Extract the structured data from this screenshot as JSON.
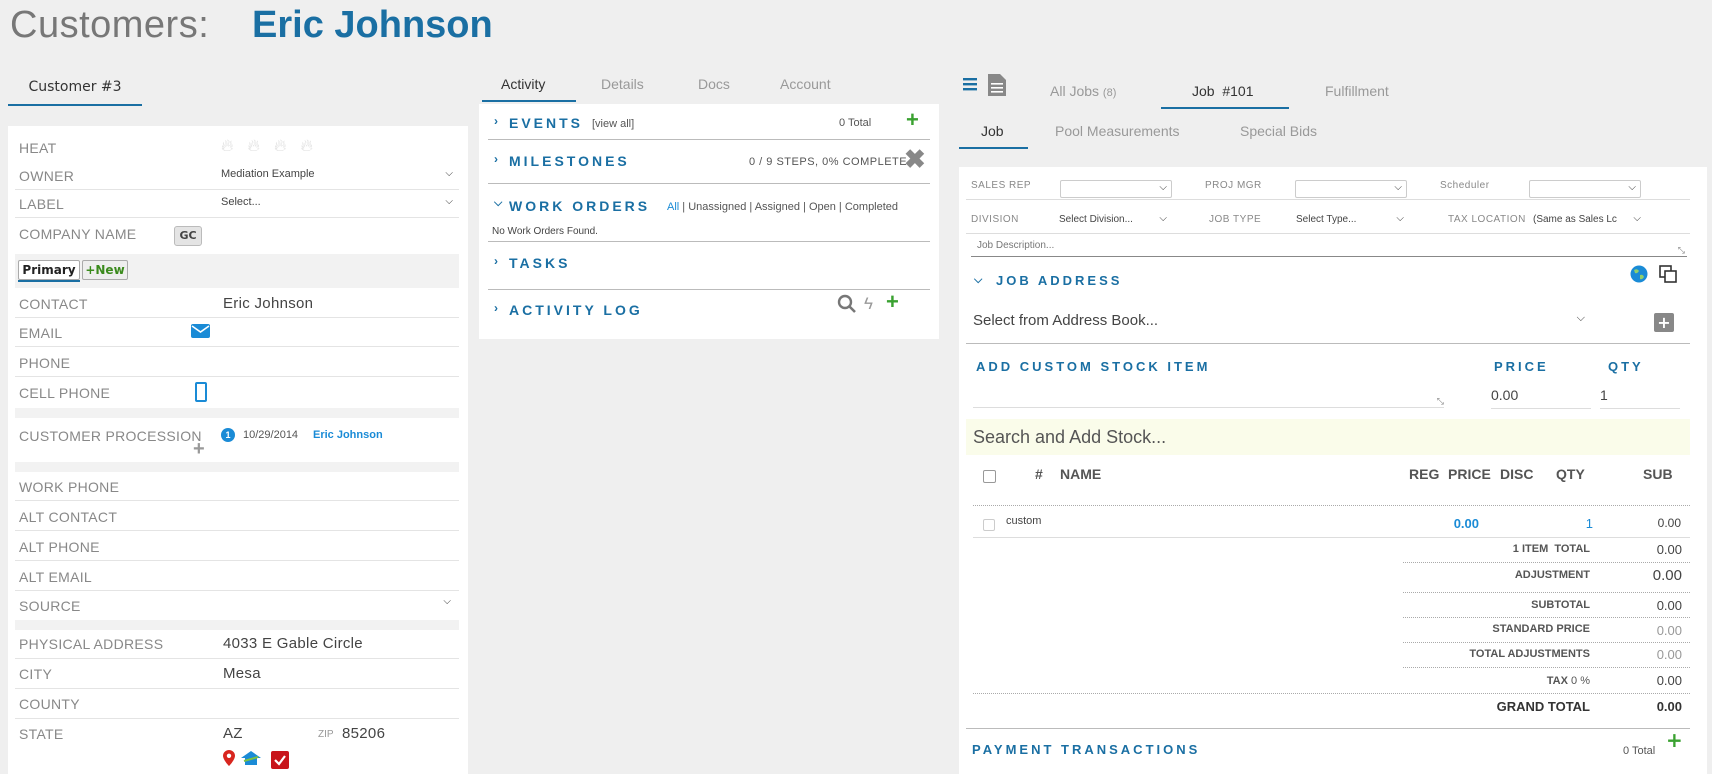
{
  "header": {
    "title": "Customers:",
    "customer_name": "Eric Johnson"
  },
  "left": {
    "tab": "Customer #3",
    "heat_label": "HEAT",
    "owner": {
      "label": "OWNER",
      "value": "Mediation Example"
    },
    "label": {
      "label": "LABEL",
      "value": "Select..."
    },
    "company_name": {
      "label": "COMPANY NAME",
      "button": "GC"
    },
    "primary_pill": "Primary",
    "new_pill": "+New",
    "contact": {
      "label": "CONTACT",
      "value": "Eric Johnson"
    },
    "email": {
      "label": "EMAIL"
    },
    "phone": {
      "label": "PHONE"
    },
    "cell_phone": {
      "label": "CELL PHONE"
    },
    "procession": {
      "label": "CUSTOMER PROCESSION",
      "badge": "1",
      "date": "10/29/2014",
      "name": "Eric Johnson"
    },
    "work_phone": {
      "label": "WORK PHONE"
    },
    "alt_contact": {
      "label": "ALT CONTACT"
    },
    "alt_phone": {
      "label": "ALT PHONE"
    },
    "alt_email": {
      "label": "ALT EMAIL"
    },
    "source": {
      "label": "SOURCE"
    },
    "physical_address": {
      "label": "PHYSICAL ADDRESS",
      "value": "4033 E Gable Circle"
    },
    "city": {
      "label": "CITY",
      "value": "Mesa"
    },
    "county": {
      "label": "COUNTY"
    },
    "state": {
      "label": "STATE",
      "value": "AZ",
      "zip_label": "ZIP",
      "zip_value": "85206"
    }
  },
  "middle": {
    "tabs": [
      "Activity",
      "Details",
      "Docs",
      "Account"
    ],
    "events": {
      "title": "EVENTS",
      "link": "[view all]",
      "total": "0 Total"
    },
    "milestones": {
      "title": "MILESTONES",
      "status": "0 / 9 STEPS, 0% COMPLETE"
    },
    "work_orders": {
      "title": "WORK ORDERS",
      "filters": [
        "All",
        "Unassigned",
        "Assigned",
        "Open",
        "Completed"
      ],
      "empty": "No Work Orders Found."
    },
    "tasks": {
      "title": "TASKS"
    },
    "activity_log": {
      "title": "ACTIVITY LOG"
    }
  },
  "right": {
    "top_tabs": {
      "all_jobs": "All Jobs",
      "all_jobs_count": "(8)",
      "job": "Job  #101",
      "fulfillment": "Fulfillment"
    },
    "sub_tabs": [
      "Job",
      "Pool Measurements",
      "Special Bids"
    ],
    "sales_rep": "SALES REP",
    "proj_mgr": "PROJ MGR",
    "scheduler": "Scheduler",
    "division": {
      "label": "DIVISION",
      "value": "Select Division..."
    },
    "job_type": {
      "label": "JOB TYPE",
      "value": "Select Type..."
    },
    "tax_location": {
      "label": "TAX LOCATION",
      "value": "(Same as Sales Lc"
    },
    "job_description_placeholder": "Job Description...",
    "job_address": {
      "title": "JOB ADDRESS",
      "select": "Select from Address Book..."
    },
    "custom_stock": {
      "title": "ADD CUSTOM STOCK ITEM",
      "price_label": "PRICE",
      "qty_label": "QTY",
      "price": "0.00",
      "qty": "1"
    },
    "search_stock": "Search and Add Stock...",
    "table_headers": {
      "num": "#",
      "name": "NAME",
      "reg": "REG",
      "price": "PRICE",
      "disc": "DISC",
      "qty": "QTY",
      "sub": "SUB"
    },
    "items": [
      {
        "name": "custom",
        "price": "0.00",
        "qty": "1",
        "sub": "0.00"
      }
    ],
    "totals": {
      "item_total_label": "1 ITEM  TOTAL",
      "item_total": "0.00",
      "adjustment_label": "ADJUSTMENT",
      "adjustment": "0.00",
      "subtotal_label": "SUBTOTAL",
      "subtotal": "0.00",
      "standard_price_label": "STANDARD PRICE",
      "standard_price": "0.00",
      "total_adjustments_label": "TOTAL ADJUSTMENTS",
      "total_adjustments": "0.00",
      "tax_label": "TAX",
      "tax_rate": "0 %",
      "tax": "0.00",
      "grand_total_label": "GRAND TOTAL",
      "grand_total": "0.00"
    },
    "payment_transactions": {
      "title": "PAYMENT TRANSACTIONS",
      "total": "0 Total"
    }
  },
  "colors": {
    "accent": "#1a6fa3",
    "add_green": "#3aa130",
    "search_bg": "#fafcea"
  }
}
